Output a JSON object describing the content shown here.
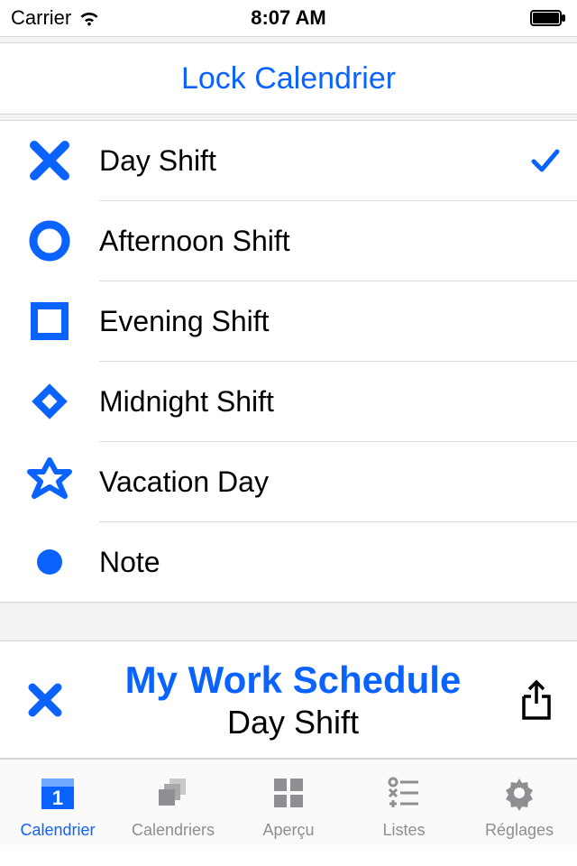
{
  "colors": {
    "accent": "#0b63ff",
    "inactive": "#8e8e93"
  },
  "status_bar": {
    "carrier": "Carrier",
    "time": "8:07 AM"
  },
  "header": {
    "title": "Lock Calendrier"
  },
  "shifts": [
    {
      "icon": "x-icon",
      "label": "Day Shift",
      "checked": true
    },
    {
      "icon": "circle-icon",
      "label": "Afternoon Shift",
      "checked": false
    },
    {
      "icon": "square-icon",
      "label": "Evening Shift",
      "checked": false
    },
    {
      "icon": "diamond-icon",
      "label": "Midnight Shift",
      "checked": false
    },
    {
      "icon": "star-icon",
      "label": "Vacation Day",
      "checked": false
    },
    {
      "icon": "dot-icon",
      "label": "Note",
      "checked": false
    }
  ],
  "footer": {
    "title": "My Work Schedule",
    "subtitle": "Day Shift"
  },
  "tabs": [
    {
      "id": "calendrier",
      "label": "Calendrier",
      "icon": "calendar-day-icon",
      "badge": "1",
      "active": true
    },
    {
      "id": "calendriers",
      "label": "Calendriers",
      "icon": "stack-icon",
      "active": false
    },
    {
      "id": "apercu",
      "label": "Aperçu",
      "icon": "grid-icon",
      "active": false
    },
    {
      "id": "listes",
      "label": "Listes",
      "icon": "list-icon",
      "active": false
    },
    {
      "id": "reglages",
      "label": "Réglages",
      "icon": "gear-icon",
      "active": false
    }
  ]
}
